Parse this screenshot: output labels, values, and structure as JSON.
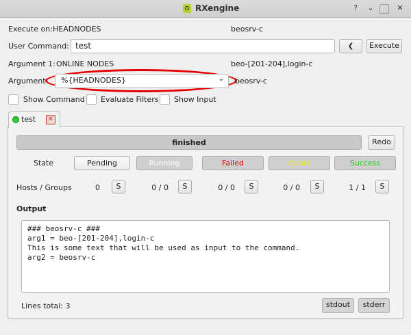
{
  "window": {
    "title": "RXengine"
  },
  "execute_on": {
    "label": "Execute on:",
    "value": "HEADNODES",
    "target": "beosrv-c"
  },
  "user_command": {
    "label": "User Command:",
    "value": "test",
    "execute_label": "Execute"
  },
  "argument1": {
    "label": "Argument 1:",
    "value": "ONLINE NODES",
    "resolved": "beo-[201-204],login-c"
  },
  "argument2": {
    "label": "Argument",
    "selected": "%{HEADNODES}",
    "resolved": "beosrv-c"
  },
  "options": {
    "show_command": "Show Command",
    "evaluate_filters": "Evaluate Filters",
    "show_input": "Show Input"
  },
  "tab": {
    "label": "test",
    "status_color": "#33cc33"
  },
  "progress": {
    "label": "finished",
    "fraction": 1.0,
    "redo_label": "Redo"
  },
  "state": {
    "label": "State",
    "items": [
      {
        "label": "Pending",
        "color": "#222222"
      },
      {
        "label": "Running",
        "color": "#ffffff"
      },
      {
        "label": "Failed",
        "color": "#e00000"
      },
      {
        "label": "Errors",
        "color": "#e6e020"
      },
      {
        "label": "Success",
        "color": "#22cc22"
      }
    ]
  },
  "hosts": {
    "label": "Hosts / Groups",
    "counts": [
      "0",
      "0 / 0",
      "0 / 0",
      "0 / 0",
      "1 / 1"
    ],
    "s_label": "S"
  },
  "output": {
    "label": "Output",
    "lines": [
      "### beosrv-c ###",
      "arg1 = beo-[201-204],login-c",
      "This is some text that will be used as input to the command.",
      "arg2 = beosrv-c"
    ],
    "lines_total": "Lines total: 3",
    "stdout_label": "stdout",
    "stderr_label": "stderr"
  }
}
